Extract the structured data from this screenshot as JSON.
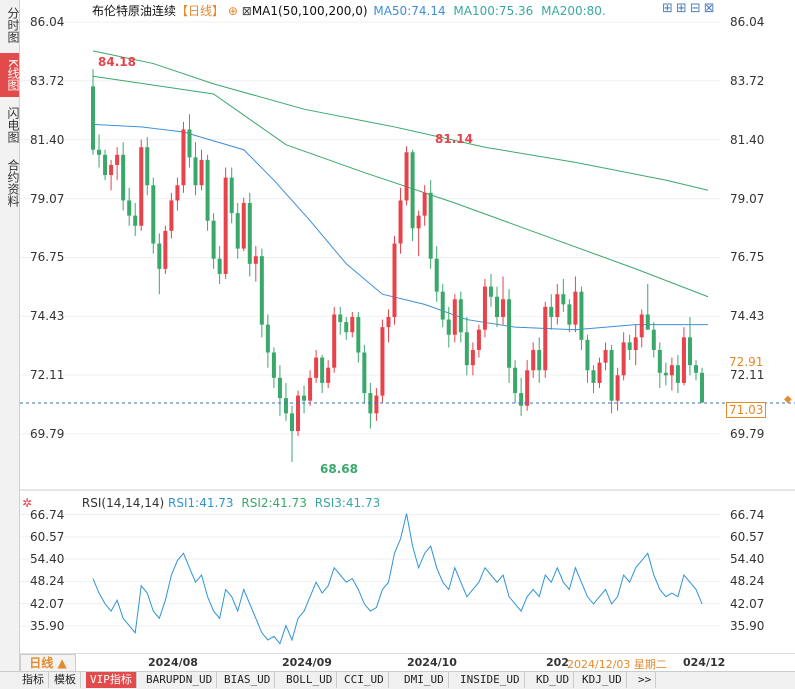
{
  "sidebar": {
    "items": [
      {
        "label": "分时图"
      },
      {
        "label": "K线图"
      },
      {
        "label": "闪电图"
      },
      {
        "label": "合约资料"
      }
    ]
  },
  "header": {
    "title": "布伦特原油连续",
    "period": "【日线】",
    "ma_label": "MA1(50,100,200,0)",
    "ma50": "MA50:74.14",
    "ma100": "MA100:75.36",
    "ma200": "MA200:80."
  },
  "price_axis": {
    "ticks": [
      "86.04",
      "83.72",
      "81.40",
      "79.07",
      "76.75",
      "74.43",
      "72.11",
      "69.79"
    ],
    "left_ticks": [
      "86.04",
      "83.72",
      "81.40",
      "79.07",
      "76.75",
      "74.43",
      "72.11",
      "69.79"
    ]
  },
  "annotations": {
    "high": "84.18",
    "mid_high": "81.14",
    "low": "68.68",
    "ma_tag": "72.91",
    "last_price": "71.03"
  },
  "rsi": {
    "label": "RSI(14,14,14)",
    "rsi1": "RSI1:41.73",
    "rsi2": "RSI2:41.73",
    "rsi3": "RSI3:41.73",
    "ticks": [
      "66.74",
      "60.57",
      "54.40",
      "48.24",
      "42.07",
      "35.90"
    ]
  },
  "time_axis": {
    "period_button": "日线",
    "labels": [
      "2024/08",
      "2024/09",
      "2024/10",
      "202"
    ],
    "cursor": "2024/12/03 星期二",
    "last": "024/12"
  },
  "tabs": [
    "指标",
    "模板",
    "VIP指标",
    "BARUPDN_UD",
    "BIAS_UD",
    "BOLL_UD",
    "CCI_UD",
    "DMI_UD",
    "INSIDE_UD",
    "KD_UD",
    "KDJ_UD",
    ">>"
  ],
  "colors": {
    "up": "#e8434b",
    "down": "#3aa86b",
    "ma50": "#3c8fd8",
    "ma100": "#3aa86b",
    "ma200": "#3aa8a0",
    "rsi": "#2f94d6"
  },
  "chart_data": {
    "type": "candlestick",
    "ylim": [
      68.68,
      86.04
    ],
    "candles": [
      [
        83.5,
        84.18,
        80.8,
        81.0
      ],
      [
        81.0,
        81.6,
        80.3,
        80.8
      ],
      [
        80.8,
        81.0,
        79.8,
        80.0
      ],
      [
        80.0,
        80.6,
        79.4,
        80.4
      ],
      [
        80.4,
        81.1,
        79.8,
        80.8
      ],
      [
        80.8,
        81.3,
        78.6,
        79.0
      ],
      [
        79.0,
        79.5,
        78.0,
        78.4
      ],
      [
        78.4,
        78.9,
        77.6,
        78.0
      ],
      [
        78.0,
        81.4,
        77.8,
        81.1
      ],
      [
        81.1,
        81.5,
        79.2,
        79.6
      ],
      [
        79.6,
        79.9,
        76.9,
        77.3
      ],
      [
        77.3,
        77.7,
        75.3,
        76.3
      ],
      [
        76.3,
        78.0,
        76.1,
        77.8
      ],
      [
        77.8,
        79.3,
        77.5,
        79.0
      ],
      [
        79.0,
        79.9,
        78.6,
        79.6
      ],
      [
        79.6,
        82.1,
        79.3,
        81.8
      ],
      [
        81.8,
        82.4,
        80.3,
        80.7
      ],
      [
        80.7,
        81.3,
        79.2,
        79.6
      ],
      [
        79.6,
        81.0,
        79.4,
        80.6
      ],
      [
        80.6,
        80.8,
        77.8,
        78.2
      ],
      [
        78.2,
        78.5,
        76.3,
        76.7
      ],
      [
        76.7,
        77.2,
        75.7,
        76.1
      ],
      [
        76.1,
        80.3,
        75.9,
        79.9
      ],
      [
        79.9,
        80.3,
        78.1,
        78.5
      ],
      [
        78.5,
        78.9,
        76.7,
        77.1
      ],
      [
        77.1,
        79.1,
        77.0,
        78.9
      ],
      [
        78.9,
        79.3,
        76.0,
        76.5
      ],
      [
        76.5,
        77.2,
        75.8,
        76.8
      ],
      [
        76.8,
        77.1,
        73.6,
        74.1
      ],
      [
        74.1,
        74.5,
        72.4,
        73.0
      ],
      [
        73.0,
        73.2,
        71.6,
        72.0
      ],
      [
        72.0,
        72.5,
        70.5,
        71.2
      ],
      [
        71.2,
        71.8,
        70.3,
        70.6
      ],
      [
        70.6,
        70.9,
        68.68,
        69.9
      ],
      [
        69.9,
        71.5,
        69.7,
        71.3
      ],
      [
        71.3,
        71.7,
        70.6,
        71.1
      ],
      [
        71.1,
        72.3,
        70.9,
        72.0
      ],
      [
        72.0,
        73.1,
        71.8,
        72.8
      ],
      [
        72.8,
        72.9,
        71.4,
        71.8
      ],
      [
        71.8,
        72.7,
        71.6,
        72.4
      ],
      [
        72.4,
        74.8,
        72.2,
        74.5
      ],
      [
        74.5,
        74.8,
        73.7,
        74.2
      ],
      [
        74.2,
        74.4,
        73.5,
        73.8
      ],
      [
        73.8,
        74.6,
        73.6,
        74.4
      ],
      [
        74.4,
        74.6,
        72.6,
        73.0
      ],
      [
        73.0,
        73.3,
        71.0,
        71.4
      ],
      [
        71.4,
        71.8,
        70.0,
        70.6
      ],
      [
        70.6,
        71.6,
        70.3,
        71.3
      ],
      [
        71.3,
        74.3,
        71.0,
        74.0
      ],
      [
        74.0,
        74.7,
        73.4,
        74.4
      ],
      [
        74.4,
        77.6,
        74.1,
        77.3
      ],
      [
        77.3,
        79.5,
        76.9,
        79.0
      ],
      [
        79.0,
        81.14,
        78.8,
        80.9
      ],
      [
        80.9,
        81.0,
        77.4,
        77.9
      ],
      [
        77.9,
        78.6,
        76.8,
        78.4
      ],
      [
        78.4,
        79.6,
        78.0,
        79.3
      ],
      [
        79.3,
        79.8,
        76.3,
        76.7
      ],
      [
        76.7,
        77.2,
        75.0,
        75.4
      ],
      [
        75.4,
        75.7,
        74.0,
        74.3
      ],
      [
        74.3,
        74.8,
        73.2,
        73.7
      ],
      [
        73.7,
        75.3,
        73.4,
        75.1
      ],
      [
        75.1,
        75.4,
        73.4,
        73.8
      ],
      [
        73.8,
        74.4,
        72.1,
        72.5
      ],
      [
        72.5,
        73.4,
        72.1,
        73.1
      ],
      [
        73.1,
        74.1,
        72.8,
        73.9
      ],
      [
        73.9,
        75.9,
        73.6,
        75.6
      ],
      [
        75.6,
        76.1,
        74.8,
        75.2
      ],
      [
        75.2,
        75.6,
        74.0,
        74.4
      ],
      [
        74.4,
        76.0,
        74.1,
        75.1
      ],
      [
        75.1,
        75.5,
        71.8,
        72.4
      ],
      [
        72.4,
        72.7,
        71.0,
        71.4
      ],
      [
        71.4,
        72.0,
        70.5,
        70.9
      ],
      [
        70.9,
        72.7,
        70.7,
        72.3
      ],
      [
        72.3,
        73.4,
        72.0,
        73.1
      ],
      [
        73.1,
        73.6,
        71.8,
        72.3
      ],
      [
        72.3,
        75.0,
        72.0,
        74.8
      ],
      [
        74.8,
        75.3,
        73.9,
        74.4
      ],
      [
        74.4,
        75.7,
        74.1,
        75.3
      ],
      [
        75.3,
        75.9,
        74.6,
        74.9
      ],
      [
        74.9,
        75.1,
        73.8,
        74.1
      ],
      [
        74.1,
        76.0,
        73.8,
        75.4
      ],
      [
        75.4,
        75.6,
        73.1,
        73.5
      ],
      [
        73.5,
        73.7,
        71.8,
        72.3
      ],
      [
        72.3,
        72.5,
        71.4,
        71.8
      ],
      [
        71.8,
        72.8,
        71.6,
        72.6
      ],
      [
        72.6,
        73.4,
        72.3,
        73.1
      ],
      [
        73.1,
        73.3,
        70.6,
        71.1
      ],
      [
        71.1,
        72.4,
        70.7,
        72.1
      ],
      [
        72.1,
        73.8,
        71.9,
        73.4
      ],
      [
        73.4,
        73.7,
        72.7,
        73.1
      ],
      [
        73.1,
        74.1,
        72.5,
        73.6
      ],
      [
        73.6,
        74.7,
        73.2,
        74.5
      ],
      [
        74.5,
        75.7,
        73.9,
        73.9
      ],
      [
        73.9,
        74.2,
        72.8,
        73.1
      ],
      [
        73.1,
        73.4,
        71.6,
        72.2
      ],
      [
        72.2,
        72.6,
        71.7,
        72.1
      ],
      [
        72.1,
        72.8,
        71.5,
        72.5
      ],
      [
        72.5,
        72.9,
        71.4,
        71.8
      ],
      [
        71.8,
        74.0,
        71.7,
        73.6
      ],
      [
        73.6,
        74.4,
        72.1,
        72.5
      ],
      [
        72.5,
        72.7,
        71.9,
        72.2
      ],
      [
        72.2,
        72.4,
        71.0,
        71.03
      ]
    ],
    "ma50": [
      [
        0,
        83.9
      ],
      [
        20,
        83.2
      ],
      [
        32,
        81.2
      ],
      [
        45,
        80.1
      ],
      [
        60,
        78.9
      ],
      [
        75,
        77.6
      ],
      [
        90,
        76.3
      ],
      [
        102,
        75.2
      ]
    ],
    "ma100": [
      [
        0,
        84.9
      ],
      [
        10,
        84.4
      ],
      [
        20,
        83.6
      ],
      [
        35,
        82.6
      ],
      [
        50,
        81.9
      ],
      [
        65,
        81.1
      ],
      [
        80,
        80.5
      ],
      [
        95,
        79.8
      ],
      [
        102,
        79.4
      ]
    ],
    "ma200": [
      [
        0,
        82.0
      ],
      [
        8,
        81.9
      ],
      [
        15,
        81.7
      ],
      [
        25,
        81.0
      ],
      [
        30,
        79.8
      ],
      [
        36,
        78.2
      ],
      [
        42,
        76.5
      ],
      [
        48,
        75.3
      ],
      [
        55,
        74.9
      ],
      [
        62,
        74.3
      ],
      [
        70,
        74.0
      ],
      [
        80,
        73.9
      ],
      [
        90,
        74.1
      ],
      [
        102,
        74.1
      ]
    ],
    "rsi_values": [
      49,
      45,
      42,
      40,
      43,
      38,
      36,
      34,
      47,
      45,
      40,
      38,
      43,
      50,
      54,
      56,
      52,
      48,
      50,
      44,
      40,
      38,
      46,
      44,
      40,
      46,
      42,
      38,
      34,
      32,
      33,
      31,
      36,
      32,
      38,
      40,
      44,
      48,
      45,
      47,
      52,
      50,
      48,
      49,
      46,
      42,
      40,
      41,
      46,
      48,
      56,
      60,
      67,
      58,
      52,
      56,
      58,
      52,
      48,
      46,
      52,
      48,
      44,
      46,
      48,
      52,
      50,
      48,
      50,
      44,
      42,
      40,
      44,
      46,
      44,
      50,
      48,
      52,
      48,
      46,
      52,
      48,
      44,
      42,
      44,
      46,
      42,
      44,
      50,
      48,
      52,
      54,
      56,
      50,
      46,
      44,
      45,
      44,
      50,
      48,
      46,
      42
    ],
    "rsi_ylim": [
      32.0,
      68.0
    ]
  }
}
